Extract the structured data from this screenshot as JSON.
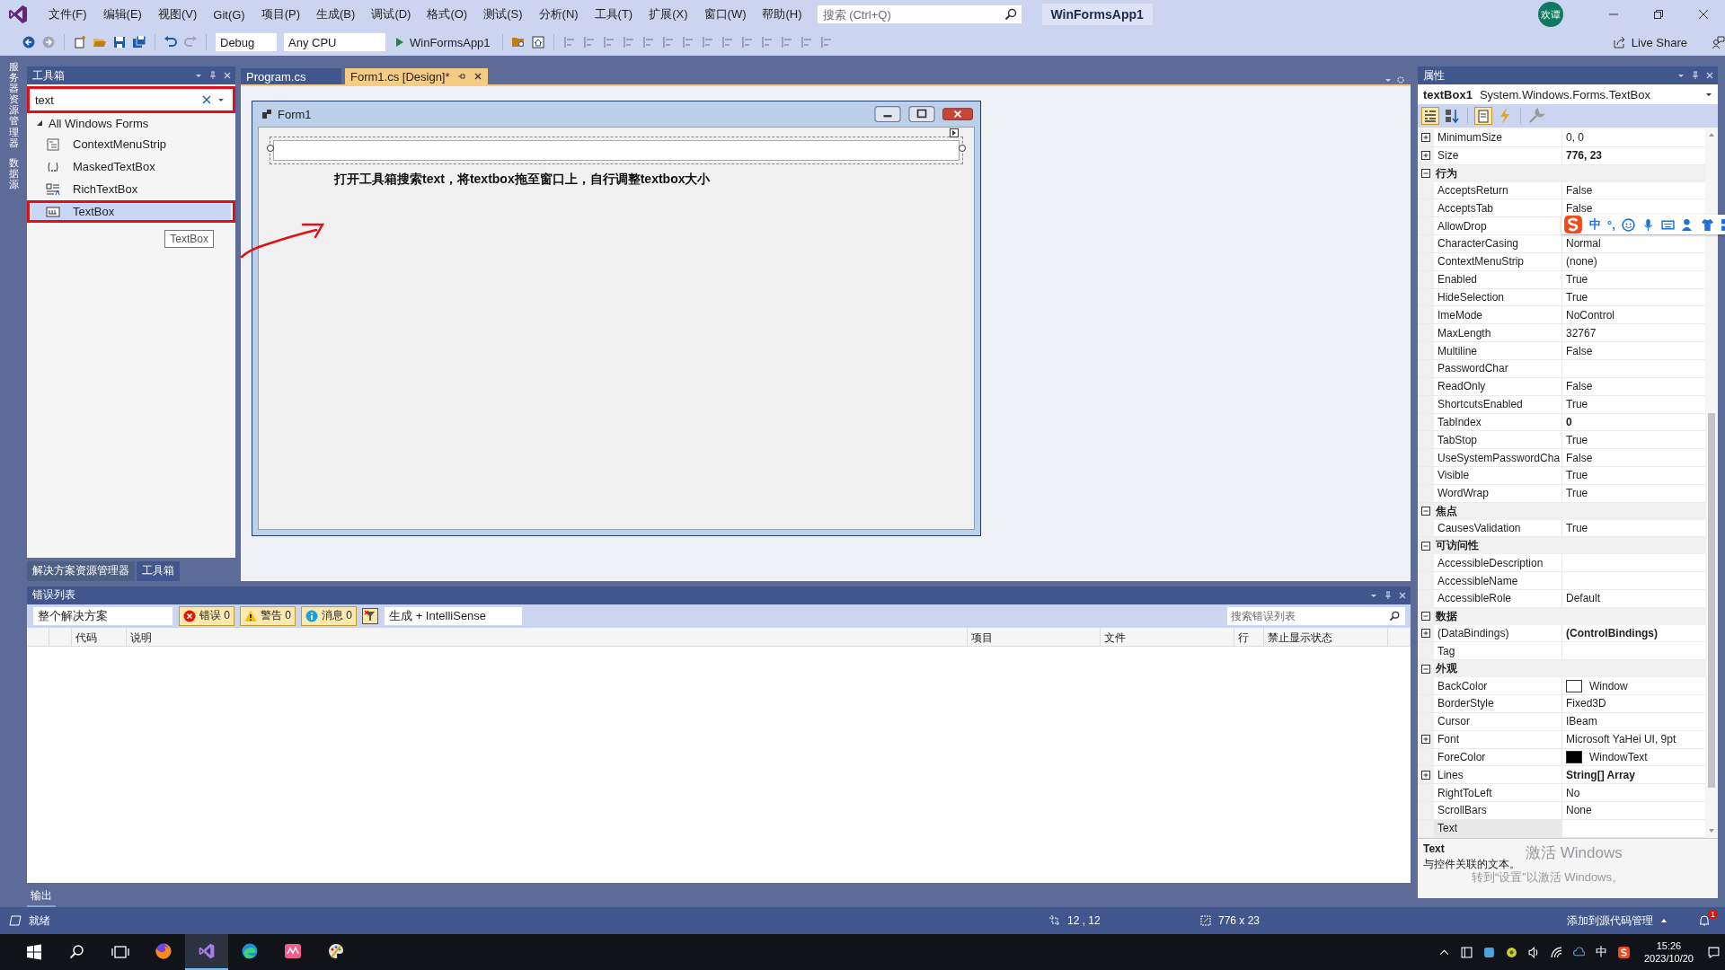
{
  "title_bar": {
    "menu": [
      "文件(F)",
      "编辑(E)",
      "视图(V)",
      "Git(G)",
      "项目(P)",
      "生成(B)",
      "调试(D)",
      "格式(O)",
      "测试(S)",
      "分析(N)",
      "工具(T)",
      "扩展(X)",
      "窗口(W)",
      "帮助(H)"
    ],
    "search": {
      "placeholder": "搜索 (Ctrl+Q)"
    },
    "solution": "WinFormsApp1",
    "avatar": "欢谭"
  },
  "toolbar": {
    "configuration": "Debug",
    "platform": "Any CPU",
    "start": "WinFormsApp1",
    "live_share": "Live Share"
  },
  "side_tabs": [
    "服务器资源管理器",
    "数据源"
  ],
  "toolbox": {
    "title": "工具箱",
    "search": {
      "value": "text"
    },
    "group": {
      "label": "All Windows Forms",
      "expanded": true
    },
    "items": [
      {
        "label": "ContextMenuStrip",
        "selected": false,
        "highlighted": false
      },
      {
        "label": "MaskedTextBox",
        "selected": false,
        "highlighted": false
      },
      {
        "label": "RichTextBox",
        "selected": false,
        "highlighted": false
      },
      {
        "label": "TextBox",
        "selected": true,
        "highlighted": true
      }
    ],
    "tooltip": "TextBox",
    "tabs": [
      {
        "label": "解决方案资源管理器",
        "selected": false
      },
      {
        "label": "工具箱",
        "selected": true
      }
    ]
  },
  "doc_tabs": [
    {
      "label": "Program.cs",
      "selected": false
    },
    {
      "label": "Form1.cs [Design]*",
      "selected": true
    }
  ],
  "form": {
    "title": "Form1"
  },
  "annotation": "打开工具箱搜索text，将textbox拖至窗口上，自行调整textbox大小",
  "properties": {
    "title": "属性",
    "object_name": "textBox1",
    "object_type": "System.Windows.Forms.TextBox",
    "rows": [
      {
        "kind": "property",
        "name": "MinimumSize",
        "value": "0, 0",
        "expandable": true,
        "bold": false
      },
      {
        "kind": "property",
        "name": "Size",
        "value": "776, 23",
        "expandable": true,
        "bold": true
      },
      {
        "kind": "category",
        "name": "行为",
        "expanded": true
      },
      {
        "kind": "property",
        "name": "AcceptsReturn",
        "value": "False",
        "expandable": false,
        "bold": false
      },
      {
        "kind": "property",
        "name": "AcceptsTab",
        "value": "False",
        "expandable": false,
        "bold": false
      },
      {
        "kind": "property",
        "name": "AllowDrop",
        "expandable": false
      },
      {
        "kind": "property",
        "name": "CharacterCasing",
        "value": "Normal",
        "expandable": false,
        "bold": false
      },
      {
        "kind": "property",
        "name": "ContextMenuStrip",
        "value": "(none)",
        "expandable": false,
        "bold": false
      },
      {
        "kind": "property",
        "name": "Enabled",
        "value": "True",
        "expandable": false,
        "bold": false
      },
      {
        "kind": "property",
        "name": "HideSelection",
        "value": "True",
        "expandable": false,
        "bold": false
      },
      {
        "kind": "property",
        "name": "ImeMode",
        "value": "NoControl",
        "expandable": false,
        "bold": false
      },
      {
        "kind": "property",
        "name": "MaxLength",
        "value": "32767",
        "expandable": false,
        "bold": false
      },
      {
        "kind": "property",
        "name": "Multiline",
        "value": "False",
        "expandable": false,
        "bold": false
      },
      {
        "kind": "property",
        "name": "PasswordChar",
        "expandable": false
      },
      {
        "kind": "property",
        "name": "ReadOnly",
        "value": "False",
        "expandable": false,
        "bold": false
      },
      {
        "kind": "property",
        "name": "ShortcutsEnabled",
        "value": "True",
        "expandable": false,
        "bold": false
      },
      {
        "kind": "property",
        "name": "TabIndex",
        "value": "0",
        "expandable": false,
        "bold": true
      },
      {
        "kind": "property",
        "name": "TabStop",
        "value": "True",
        "expandable": false,
        "bold": false
      },
      {
        "kind": "property",
        "name": "UseSystemPasswordCha",
        "value": "False",
        "expandable": false,
        "bold": false
      },
      {
        "kind": "property",
        "name": "Visible",
        "value": "True",
        "expandable": false,
        "bold": false
      },
      {
        "kind": "property",
        "name": "WordWrap",
        "value": "True",
        "expandable": false,
        "bold": false
      },
      {
        "kind": "category",
        "name": "焦点",
        "expanded": true
      },
      {
        "kind": "property",
        "name": "CausesValidation",
        "value": "True",
        "expandable": false,
        "bold": false
      },
      {
        "kind": "category",
        "name": "可访问性",
        "expanded": true
      },
      {
        "kind": "property",
        "name": "AccessibleDescription",
        "expandable": false
      },
      {
        "kind": "property",
        "name": "AccessibleName",
        "expandable": false
      },
      {
        "kind": "property",
        "name": "AccessibleRole",
        "value": "Default",
        "expandable": false,
        "bold": false
      },
      {
        "kind": "category",
        "name": "数据",
        "expanded": true
      },
      {
        "kind": "property",
        "name": "(DataBindings)",
        "value": "(ControlBindings)",
        "expandable": true,
        "bold": true
      },
      {
        "kind": "property",
        "name": "Tag",
        "expandable": false
      },
      {
        "kind": "category",
        "name": "外观",
        "expanded": true
      },
      {
        "kind": "property",
        "name": "BackColor",
        "value": "Window",
        "color": "#ffffff",
        "expandable": false,
        "bold": false
      },
      {
        "kind": "property",
        "name": "BorderStyle",
        "value": "Fixed3D",
        "expandable": false,
        "bold": false
      },
      {
        "kind": "property",
        "name": "Cursor",
        "value": "IBeam",
        "expandable": false,
        "bold": false
      },
      {
        "kind": "property",
        "name": "Font",
        "value": "Microsoft YaHei UI, 9pt",
        "expandable": true,
        "bold": false
      },
      {
        "kind": "property",
        "name": "ForeColor",
        "value": "WindowText",
        "color": "#000000",
        "expandable": false,
        "bold": false
      },
      {
        "kind": "property",
        "name": "Lines",
        "value": "String[] Array",
        "expandable": true,
        "bold": true
      },
      {
        "kind": "property",
        "name": "RightToLeft",
        "value": "No",
        "expandable": false,
        "bold": false
      },
      {
        "kind": "property",
        "name": "ScrollBars",
        "value": "None",
        "expandable": false,
        "bold": false
      },
      {
        "kind": "property",
        "name": "Text",
        "expandable": false,
        "selected": true
      }
    ],
    "description": {
      "title": "Text",
      "text": "与控件关联的文本。"
    }
  },
  "ime_toolbar": {
    "mode": "中",
    "punctuation": "°,"
  },
  "activation": {
    "title": "激活 Windows",
    "text": "转到“设置”以激活 Windows。"
  },
  "error_list": {
    "title": "错误列表",
    "scope": "整个解决方案",
    "filters": [
      {
        "kind": "error",
        "label": "错误 0",
        "on": true
      },
      {
        "kind": "warning",
        "label": "警告 0",
        "on": true
      },
      {
        "kind": "message",
        "label": "消息 0",
        "on": true
      }
    ],
    "source": "生成 + IntelliSense",
    "search": {
      "placeholder": "搜索错误列表"
    },
    "columns": [
      "代码",
      "说明",
      "项目",
      "文件",
      "行",
      "禁止显示状态"
    ]
  },
  "output_tab": "输出",
  "status_bar": {
    "text": "就绪",
    "position": "12 , 12",
    "size": "776 x 23",
    "source_control": "添加到源代码管理",
    "notifications": "1"
  },
  "taskbar": {
    "apps": [
      {
        "kind": "firefox",
        "selected": false
      },
      {
        "kind": "vs",
        "selected": true
      },
      {
        "kind": "edge",
        "selected": false
      },
      {
        "kind": "pink",
        "selected": false
      },
      {
        "kind": "paint",
        "selected": false
      }
    ],
    "ime": "中",
    "time": "15:26",
    "date": "2023/10/20"
  }
}
